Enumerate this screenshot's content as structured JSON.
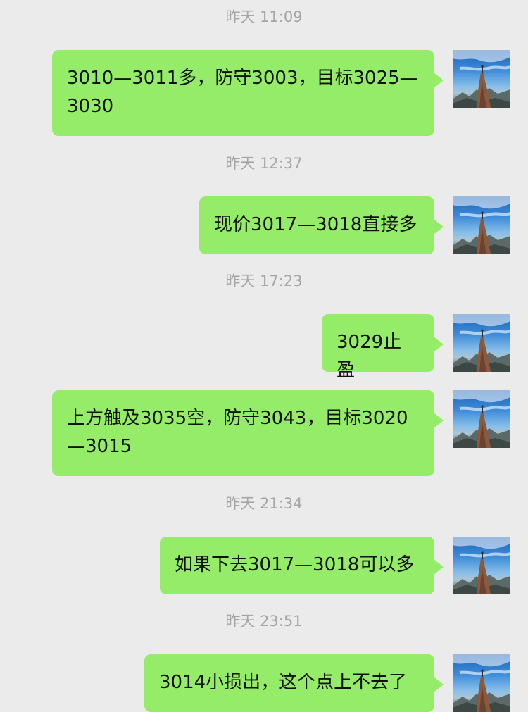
{
  "chat": {
    "messages": [
      {
        "time": "昨天 11:09",
        "text": "3010—3011多，防守3003，目标3025—3030"
      },
      {
        "time": "昨天 12:37",
        "text": "现价3017—3018直接多"
      },
      {
        "time": "昨天 17:23",
        "text": "3029止盈"
      },
      {
        "time": "",
        "text": "上方触及3035空，防守3043，目标3020—3015"
      },
      {
        "time": "昨天 21:34",
        "text": "如果下去3017—3018可以多"
      },
      {
        "time": "昨天 23:51",
        "text": "3014小损出，这个点上不去了"
      }
    ]
  },
  "colors": {
    "background": "#ebebeb",
    "bubble": "#95ec69",
    "timestamp": "#a5a5a5",
    "text": "#111111"
  },
  "icons": {
    "avatar": "avatar-mountain-climber"
  }
}
